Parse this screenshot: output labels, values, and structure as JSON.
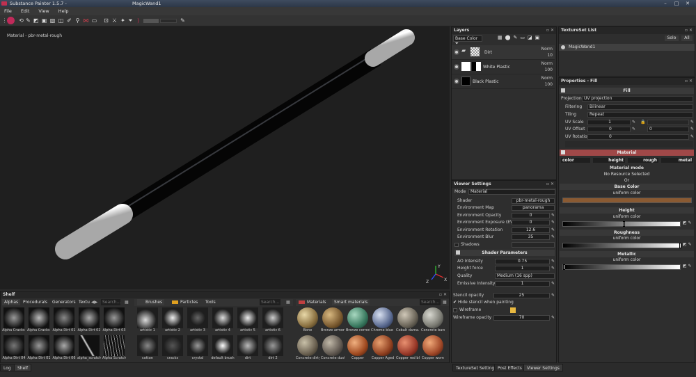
{
  "app": {
    "title": "Substance Painter 1.5.7 -",
    "document": "MagicWand1"
  },
  "window_controls": {
    "min": "–",
    "max": "□",
    "close": "✕"
  },
  "menu": [
    "File",
    "Edit",
    "View",
    "Help"
  ],
  "viewport": {
    "material_label": "Material - pbr-metal-rough",
    "gizmo_axes": {
      "x": "X",
      "y": "Y",
      "z": "Z"
    }
  },
  "layers": {
    "title": "Layers",
    "channel": "Base Color",
    "items": [
      {
        "name": "Dirt",
        "blend": "Norm",
        "opacity": "10"
      },
      {
        "name": "White Plastic",
        "blend": "Norm",
        "opacity": "100"
      },
      {
        "name": "Black Plastic",
        "blend": "Norm",
        "opacity": "100"
      }
    ]
  },
  "textureset_list": {
    "title": "TextureSet List",
    "solo": "Solo",
    "all": "All",
    "item": "MagicWand1"
  },
  "properties": {
    "title": "Properties - Fill",
    "fill_header": "Fill",
    "projection_label": "Projection",
    "projection_value": "UV projection",
    "filtering_label": "Filtering",
    "filtering_value": "Bilinear",
    "tiling_label": "Tiling",
    "tiling_value": "Repeat",
    "uv_scale_label": "UV Scale",
    "uv_scale_value": "1",
    "uv_offset_label": "UV Offset",
    "uv_offset_u": "0",
    "uv_offset_v": "0",
    "uv_rotation_label": "UV Rotation",
    "uv_rotation_value": "0",
    "material_header": "Material",
    "channels": [
      "color",
      "height",
      "rough",
      "metal"
    ],
    "material_mode_label": "Material mode",
    "material_mode_value": "No Resource Selected",
    "or": "Or",
    "base_color_label": "Base Color",
    "base_color_mode": "uniform color",
    "base_color_hex": "#8a5a32",
    "height_label": "Height",
    "height_mode": "uniform color",
    "roughness_label": "Roughness",
    "roughness_mode": "uniform color",
    "metallic_label": "Metallic",
    "metallic_mode": "uniform color"
  },
  "viewer_settings": {
    "title": "Viewer Settings",
    "mode_label": "Mode",
    "mode_value": "Material",
    "shader_label": "Shader",
    "shader_value": "pbr-metal-rough",
    "env_map_label": "Environment Map",
    "env_map_value": "panorama",
    "env_opacity_label": "Environment Opacity",
    "env_opacity_value": "0",
    "env_exposure_label": "Environment Exposure (EV)",
    "env_exposure_value": "0",
    "env_rotation_label": "Environment Rotation",
    "env_rotation_value": "12.6",
    "env_blur_label": "Environment Blur",
    "env_blur_value": "35",
    "shadows_label": "Shadows",
    "shader_params_header": "Shader Parameters",
    "ao_label": "AO Intensity",
    "ao_value": "0.75",
    "height_force_label": "Height force",
    "height_force_value": "1",
    "quality_label": "Quality",
    "quality_value": "Medium (16 spp)",
    "emissive_label": "Emissive Intensity",
    "emissive_value": "1",
    "stencil_opacity_label": "Stencil opacity",
    "stencil_opacity_value": "25",
    "hide_stencil_label": "Hide stencil when painting",
    "wireframe_label": "Wireframe",
    "wireframe_opacity_label": "Wireframe opacity",
    "wireframe_opacity_value": "70"
  },
  "shelf": {
    "title": "Shelf",
    "tabs": [
      "Alphas",
      "Procedurals",
      "Generators",
      "Textu"
    ],
    "search_placeholder": "Search...",
    "alphas": [
      "Alpha Cracks ...",
      "Alpha Cracks ...",
      "Alpha Dirt 01",
      "Alpha Dirt 02",
      "Alpha Dirt 03",
      "Alpha Dirt 04",
      "Alpha Dirt 01",
      "Alpha Dirt 06",
      "alpha_scratch...",
      "Alpha Scratch..."
    ],
    "brush_tabs": [
      "Brushes",
      "Particles",
      "Tools"
    ],
    "brushes": [
      "artistic 1",
      "artistic 2",
      "artistic 3",
      "artistic 4",
      "artistic 5",
      "artistic 6",
      "cotton",
      "cracks",
      "crystal",
      "default brush",
      "dirt",
      "dirt 2"
    ],
    "material_tabs": [
      "Materials",
      "Smart materials"
    ],
    "materials": [
      "Bone",
      "Bronze armor",
      "Bronze corrod...",
      "Chrome blue ...",
      "Cobalt dama...",
      "Concrete bare",
      "Concrete dirty",
      "Concrete dusty",
      "Copper",
      "Copper Aged",
      "Copper red bl...",
      "Copper worn"
    ]
  },
  "bottom_tabs": {
    "log": "Log",
    "shelf": "Shelf",
    "textureset_settings": "TextureSet Settings",
    "post_effects": "Post Effects",
    "viewer_settings": "Viewer Settings"
  }
}
